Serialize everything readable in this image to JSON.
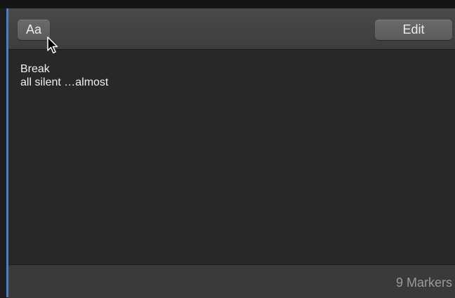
{
  "toolbar": {
    "font_button_label": "Aa",
    "edit_button_label": "Edit"
  },
  "marker": {
    "title": "Break",
    "description": "all silent …almost"
  },
  "footer": {
    "marker_count": "9 Markers"
  }
}
